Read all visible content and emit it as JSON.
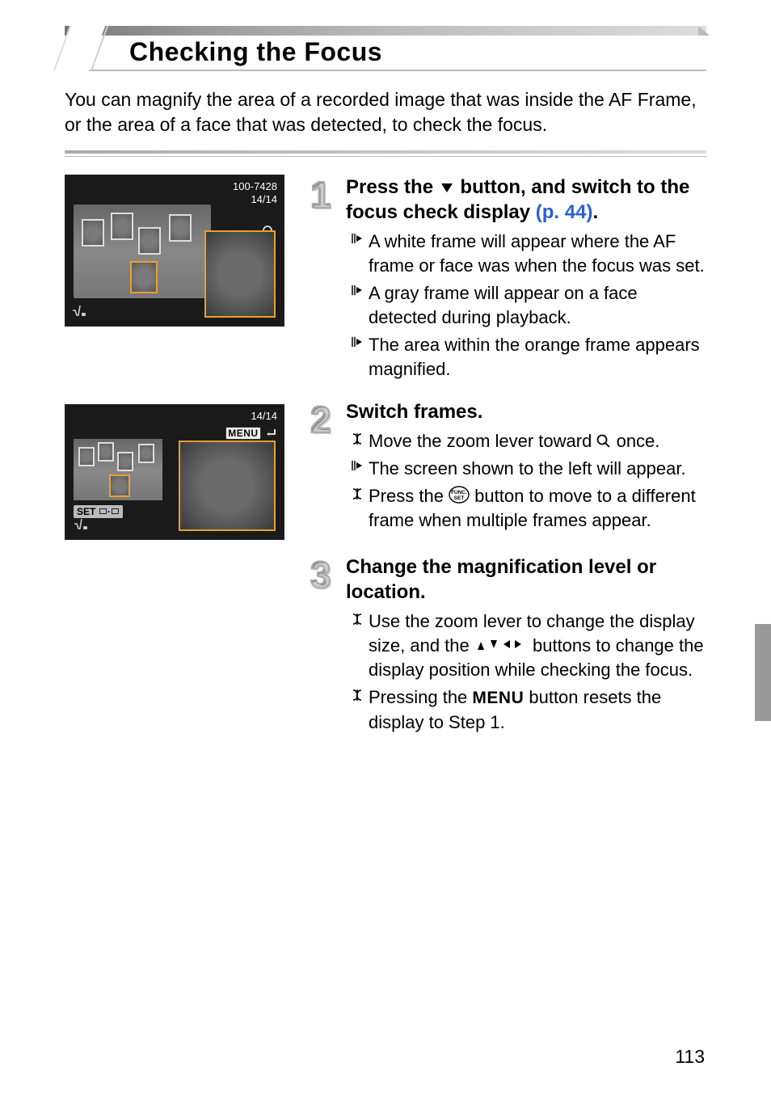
{
  "title": "Checking the Focus",
  "intro": "You can magnify the area of a recorded image that was inside the AF Frame, or the area of a face that was detected, to check the focus.",
  "shot1": {
    "fileno": "100-7428",
    "count": "14/14"
  },
  "shot2": {
    "count": "14/14",
    "menulabel": "MENU",
    "setlabel": "SET"
  },
  "step1": {
    "num": "1",
    "head_a": "Press the ",
    "head_b": " button, and switch to the focus check display ",
    "pref": "(p. 44)",
    "head_c": ".",
    "b1": "A white frame will appear where the AF frame or face was when the focus was set.",
    "b2": "A gray frame will appear on a face detected during playback.",
    "b3": "The area within the orange frame appears magnified."
  },
  "step2": {
    "num": "2",
    "head": "Switch frames.",
    "b1a": "Move the zoom lever toward ",
    "b1b": " once.",
    "b2": "The screen shown to the left will appear.",
    "b3a": "Press the ",
    "b3b": " button to move to a different frame when multiple frames appear."
  },
  "step3": {
    "num": "3",
    "head": "Change the magnification level or location.",
    "b1a": "Use the zoom lever to change the display size, and the ",
    "b1b": " buttons to change the display position while checking the focus.",
    "b2a": "Pressing the ",
    "b2b": " button resets the display to Step 1.",
    "menutext": "MENU"
  },
  "pagenum": "113"
}
